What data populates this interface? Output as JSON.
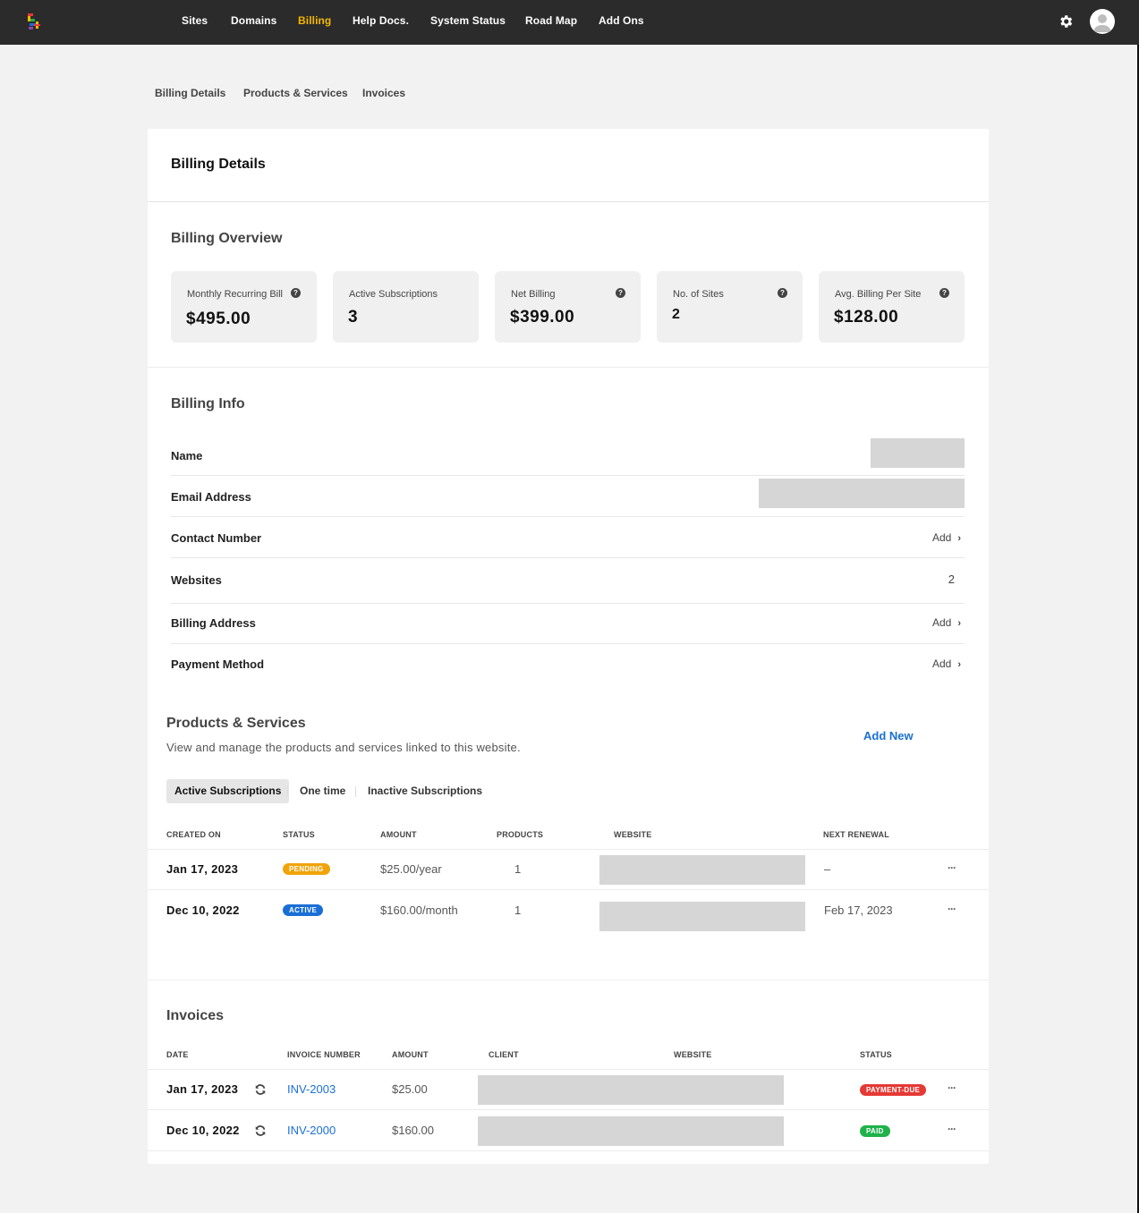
{
  "nav": {
    "items": [
      "Sites",
      "Domains",
      "Billing",
      "Help Docs.",
      "System Status",
      "Road Map",
      "Add Ons"
    ],
    "active": "Billing"
  },
  "subnav": [
    "Billing Details",
    "Products & Services",
    "Invoices"
  ],
  "page_title": "Billing Details",
  "overview": {
    "title": "Billing Overview",
    "stats": [
      {
        "label": "Monthly Recurring Bill",
        "value": "$495.00",
        "help": true
      },
      {
        "label": "Active Subscriptions",
        "value": "3",
        "help": false
      },
      {
        "label": "Net Billing",
        "value": "$399.00",
        "help": true
      },
      {
        "label": "No. of Sites",
        "value": "2",
        "help": true
      },
      {
        "label": "Avg. Billing Per Site",
        "value": "$128.00",
        "help": true
      }
    ]
  },
  "billing_info": {
    "title": "Billing Info",
    "rows": [
      {
        "label": "Name"
      },
      {
        "label": "Email Address"
      },
      {
        "label": "Contact Number",
        "action": "Add"
      },
      {
        "label": "Websites",
        "value": "2"
      },
      {
        "label": "Billing Address",
        "action": "Add"
      },
      {
        "label": "Payment Method",
        "action": "Add"
      }
    ]
  },
  "products": {
    "title": "Products & Services",
    "description": "View and manage the products and services linked to this website.",
    "add_new": "Add New",
    "tabs": [
      "Active Subscriptions",
      "One time",
      "Inactive Subscriptions"
    ],
    "columns": [
      "CREATED ON",
      "STATUS",
      "AMOUNT",
      "PRODUCTS",
      "WEBSITE",
      "NEXT RENEWAL"
    ],
    "rows": [
      {
        "created": "Jan 17, 2023",
        "status": "PENDING",
        "amount": "$25.00/year",
        "products": "1",
        "renewal": "–",
        "more": "···"
      },
      {
        "created": "Dec 10, 2022",
        "status": "ACTIVE",
        "amount": "$160.00/month",
        "products": "1",
        "renewal": "Feb 17, 2023",
        "more": "···"
      }
    ]
  },
  "invoices": {
    "title": "Invoices",
    "columns": [
      "DATE",
      "INVOICE NUMBER",
      "AMOUNT",
      "CLIENT",
      "WEBSITE",
      "STATUS"
    ],
    "rows": [
      {
        "date": "Jan 17, 2023",
        "number": "INV-2003",
        "amount": "$25.00",
        "status": "PAYMENT-DUE",
        "more": "···"
      },
      {
        "date": "Dec 10, 2022",
        "number": "INV-2000",
        "amount": "$160.00",
        "status": "PAID",
        "more": "···"
      }
    ]
  },
  "colors": {
    "topbar": "#2b2b2b",
    "nav_active": "#f5b800",
    "link": "#1a6fd6",
    "pending": "#f0a30a",
    "active": "#1a6fd6",
    "payment_due": "#e53935",
    "paid": "#1fb24a"
  },
  "icons": [
    "app-logo-icon",
    "gear-icon",
    "avatar-icon",
    "help-icon",
    "chevron-right-icon",
    "sync-icon",
    "more-icon"
  ]
}
